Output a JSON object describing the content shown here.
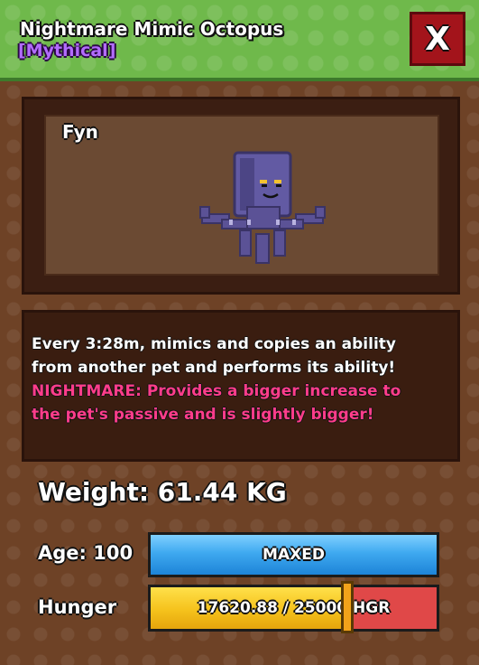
{
  "header": {
    "title": "Nightmare Mimic Octopus",
    "rarity": "[Mythical]",
    "close_label": "X"
  },
  "pet": {
    "name": "Fyn",
    "image_icon": "octopus-pet-icon"
  },
  "description": {
    "line1": "Every 3:28m, mimics and copies an ability",
    "line2": "from another pet and performs its ability!",
    "nightmare_line1": "NIGHTMARE: Provides a bigger increase to",
    "nightmare_line2": "the pet's passive and is slightly bigger!"
  },
  "stats": {
    "weight_text": "Weight: 61.44 KG",
    "age_label": "Age: 100",
    "age_bar_text": "MAXED",
    "age_progress": 1.0,
    "hunger_label": "Hunger",
    "hunger_bar_text": "17620.88 / 25000 HGR",
    "hunger_current": 17620.88,
    "hunger_max": 25000,
    "hunger_marker": 0.685
  },
  "colors": {
    "header_green": "#6fb94b",
    "rarity_purple": "#b36cff",
    "close_red": "#a3141b",
    "nightmare_pink": "#ff3d8b",
    "age_blue": "#3fa9f0",
    "hunger_yellow": "#f5c21c",
    "hunger_empty_red": "#e04848"
  }
}
